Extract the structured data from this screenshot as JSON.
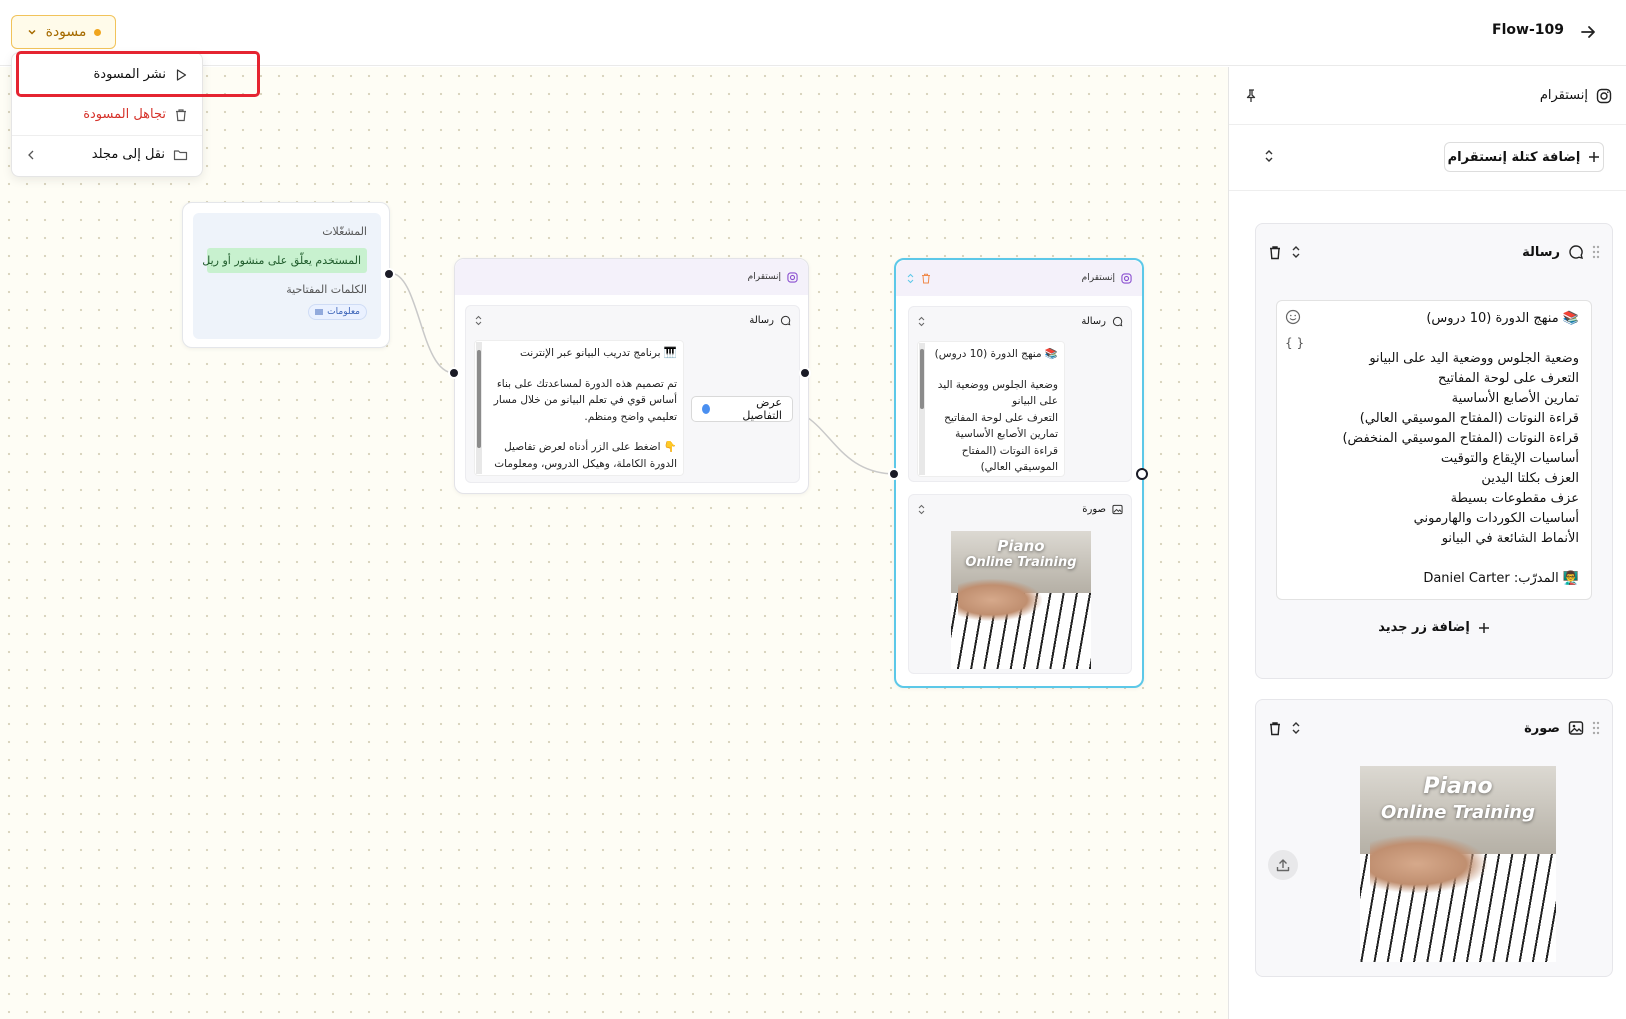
{
  "header": {
    "flow_title": "Flow-109",
    "status_label": "مسودة"
  },
  "menu": {
    "publish": "نشر المسودة",
    "discard": "تجاهل المسودة",
    "move": "نقل إلى مجلد"
  },
  "trigger_node": {
    "triggers_label": "المشغّلات",
    "trigger_text": "المستخدم يعلّق على منشور أو ريل",
    "keywords_label": "الكلمات المفتاحية",
    "keyword": "معلومات"
  },
  "node2": {
    "title": "إنستقرام",
    "msg_label": "رسالة",
    "msg_lines": [
      "🎹 برنامج تدريب البيانو عبر الإنترنت",
      "",
      "تم تصميم هذه الدورة لمساعدتك على بناء أساس قوي في تعلم البيانو من خلال مسار تعليمي واضح ومنظم.",
      "",
      "👇 اضغط على الزر أدناه لعرض تفاصيل الدورة الكاملة، وهيكل الدروس، ومعلومات"
    ],
    "button_label": "عرض التفاصيل"
  },
  "node3": {
    "title": "إنستقرام",
    "msg_label": "رسالة",
    "msg_lines": [
      "📚 منهج الدورة (10 دروس)",
      "",
      "وضعية الجلوس ووضعية اليد على البيانو",
      "التعرف على لوحة المفاتيح",
      "تمارين الأصابع الأساسية",
      "قراءة النوتات (المفتاح الموسيقي العالي)"
    ],
    "image_label": "صورة"
  },
  "image": {
    "title_line1": "Piano",
    "title_line2": "Online Training"
  },
  "panel": {
    "title": "إنستقرام",
    "add_block": "إضافة كتلة إنستقرام",
    "msg_card_title": "رسالة",
    "msg_lines": [
      "📚 منهج الدورة (10 دروس)",
      "",
      "وضعية الجلوس ووضعية اليد على البيانو",
      "التعرف على لوحة المفاتيح",
      "تمارين الأصابع الأساسية",
      "قراءة النوتات (المفتاح الموسيقي العالي)",
      "قراءة النوتات (المفتاح الموسيقي المنخفض)",
      "أساسيات الإيقاع والتوقيت",
      "العزف بكلتا اليدين",
      "عزف مقطوعات بسيطة",
      "أساسيات الكوردات والهارموني",
      "الأنماط الشائعة في البيانو",
      "",
      "👨‍🏫 المدرّب: Daniel Carter"
    ],
    "add_button": "إضافة زر جديد",
    "image_card_title": "صورة",
    "vars_icon_text": "{ }"
  },
  "colors": {
    "highlight": "#e52431",
    "draft_accent": "#f0a51d",
    "selected_node": "#5cc8e8",
    "trigger_chip": "#c8f1cf",
    "port_blue": "#4a8ff0"
  }
}
